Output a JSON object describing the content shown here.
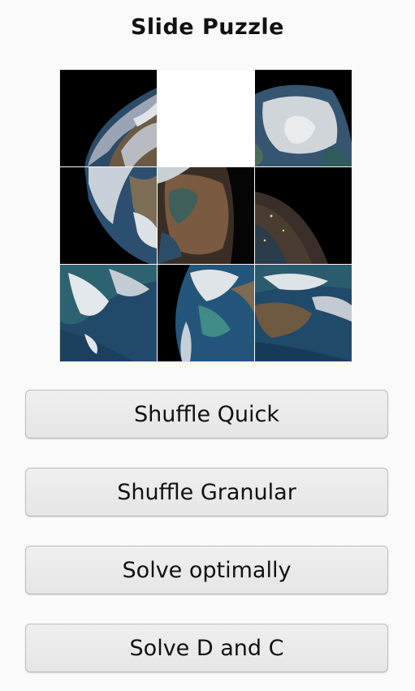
{
  "title": "Slide Puzzle",
  "puzzle": {
    "rows": 3,
    "cols": 3,
    "tiles": [
      {
        "image": "earth-left-edge-tile"
      },
      {
        "image": "empty-slot"
      },
      {
        "image": "earth-arctic-tile"
      },
      {
        "image": "earth-southwest-tile"
      },
      {
        "image": "earth-africa-night-tile"
      },
      {
        "image": "earth-night-edge-tile"
      },
      {
        "image": "earth-cloud-ocean-tile"
      },
      {
        "image": "earth-caribbean-tile"
      },
      {
        "image": "earth-ocean-coast-tile"
      }
    ]
  },
  "buttons": {
    "shuffle_quick": "Shuffle Quick",
    "shuffle_granular": "Shuffle Granular",
    "solve_optimally": "Solve optimally",
    "solve_dc": "Solve D and C"
  },
  "colors": {
    "space": "#000000",
    "ocean": "#1e4d6b",
    "cloud": "#e6ecf0",
    "land": "#7a6a4e",
    "ice": "#d8dde0",
    "button_bg": "#ececec"
  }
}
